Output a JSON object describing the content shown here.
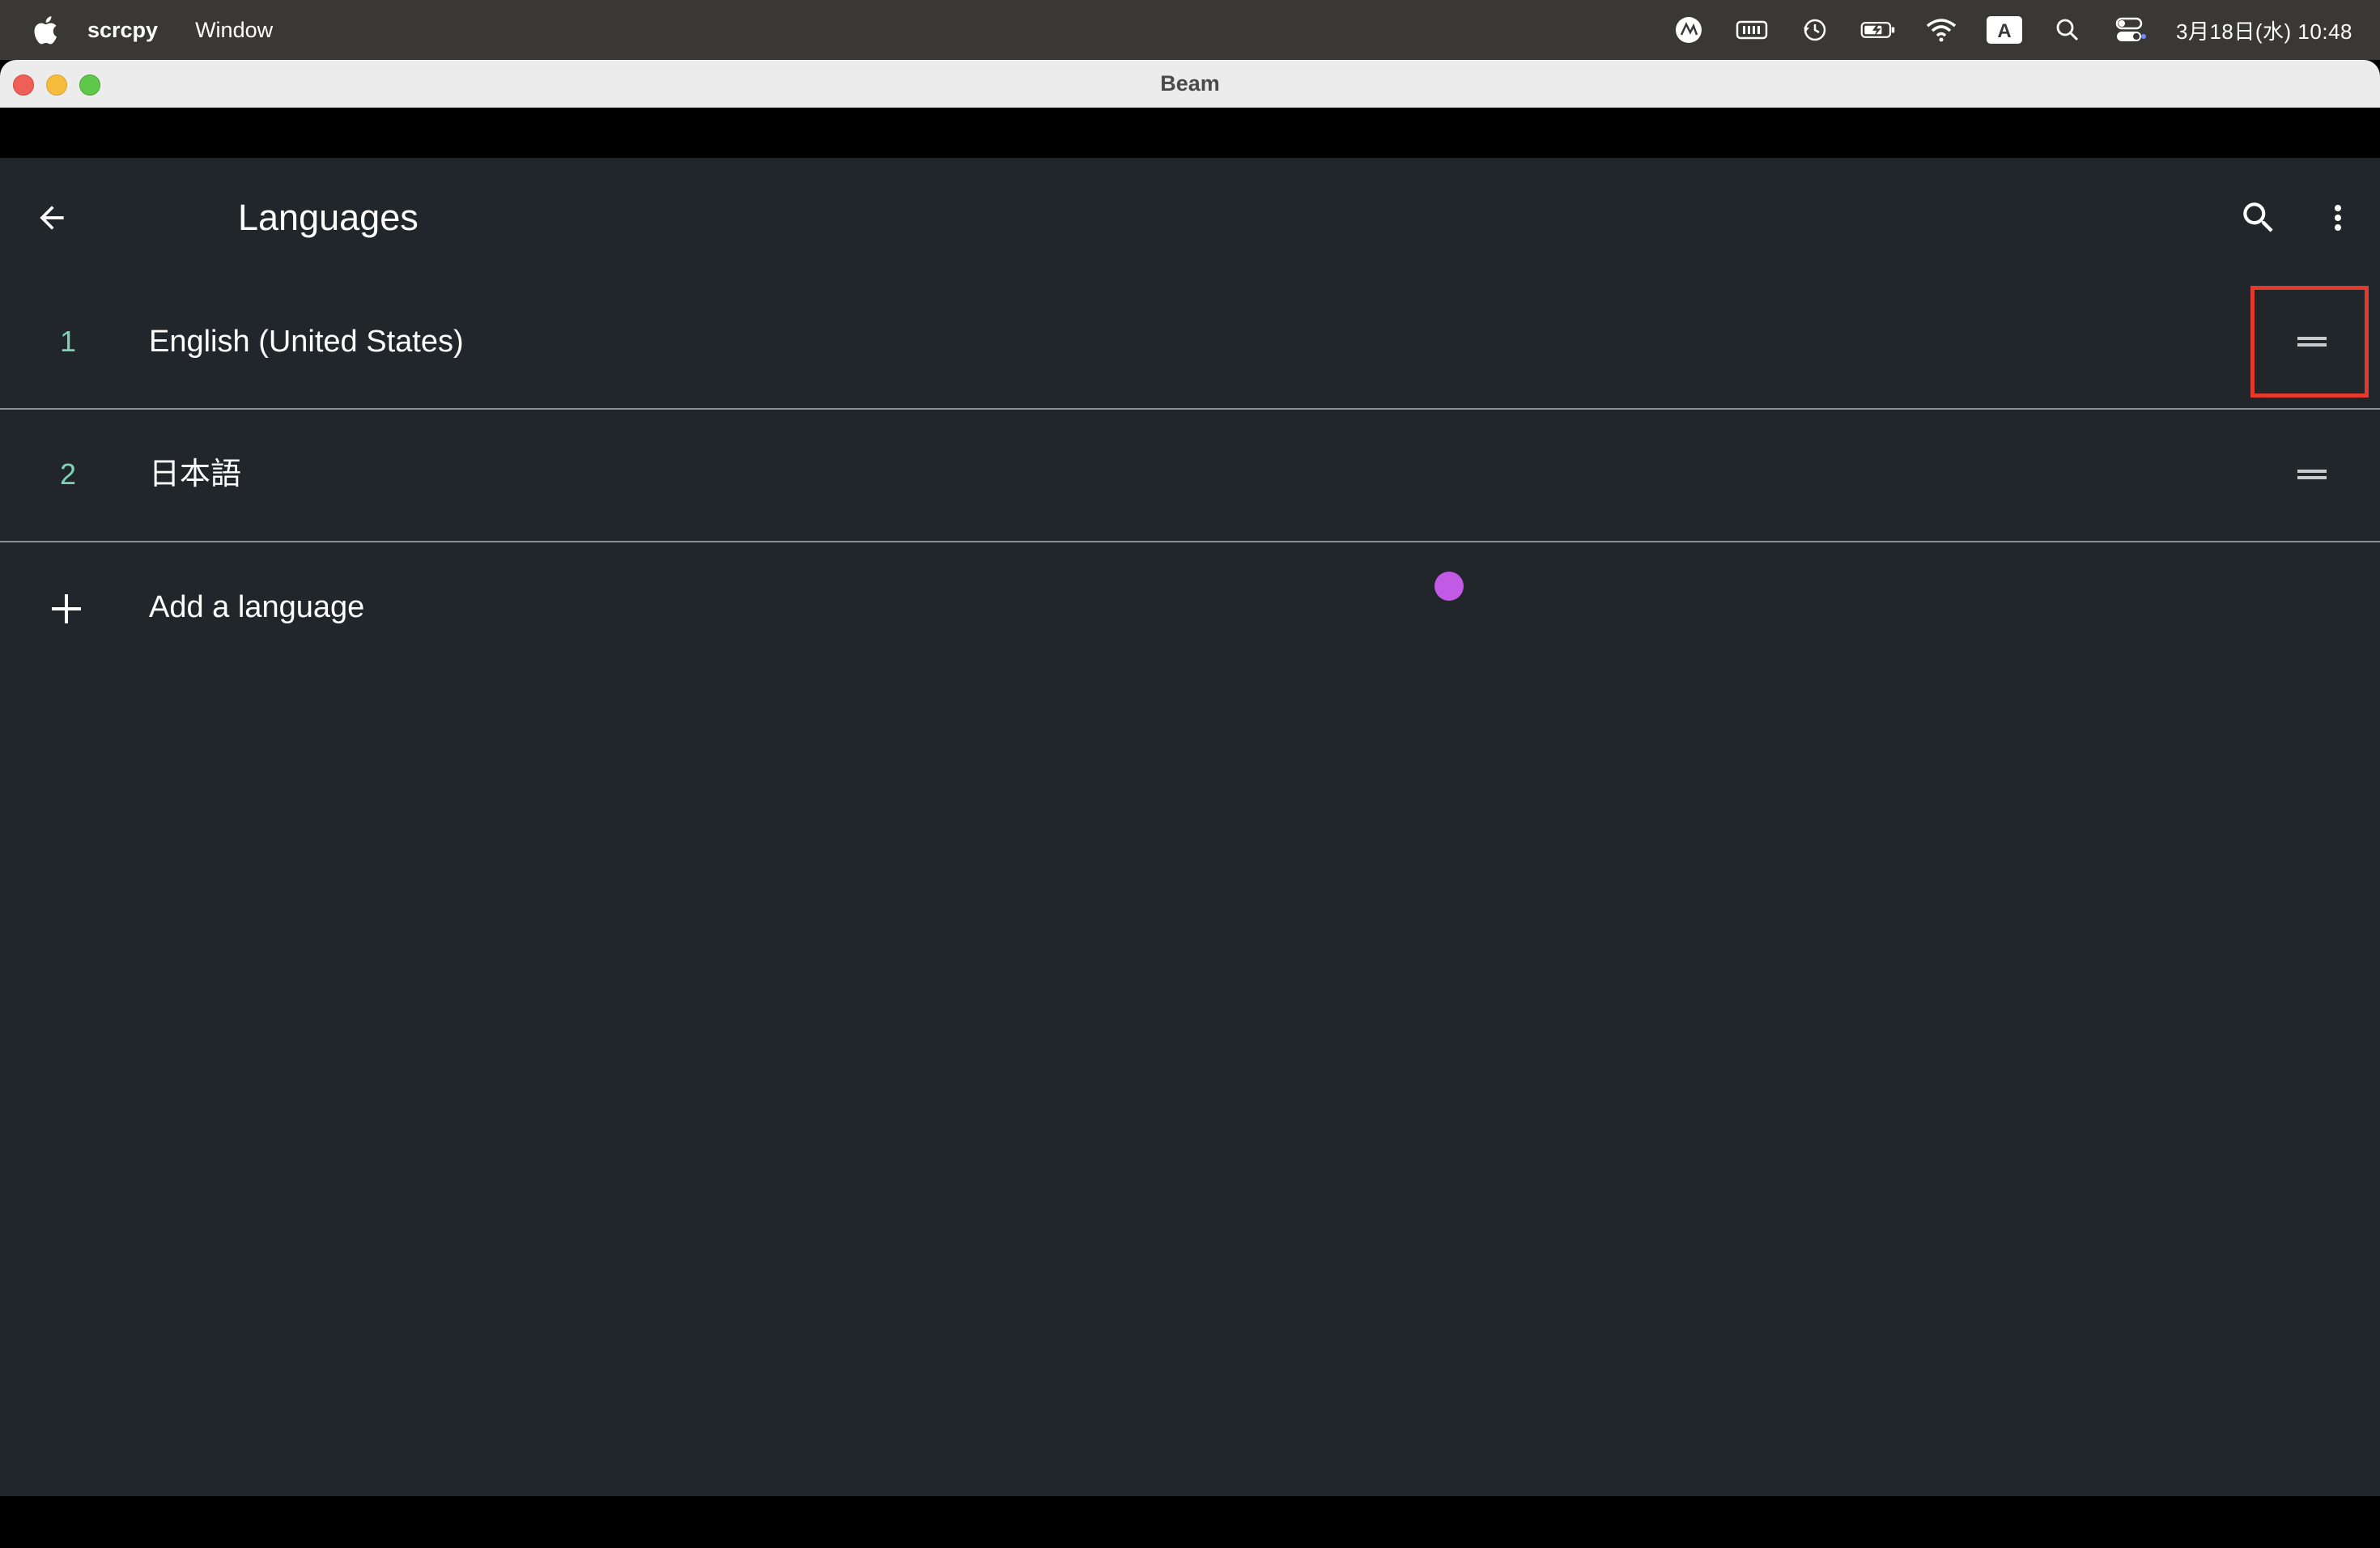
{
  "menubar": {
    "app_name": "scrcpy",
    "menu_window": "Window",
    "clock": "3月18日(水) 10:48",
    "status_icons": [
      "user-accessibility-icon",
      "keyboard-brightness-icon",
      "time-machine-icon",
      "battery-charging-icon",
      "wifi-icon",
      "input-source-icon",
      "spotlight-search-icon",
      "control-center-icon"
    ],
    "input_source_label": "A"
  },
  "window": {
    "title": "Beam"
  },
  "appbar": {
    "title": "Languages"
  },
  "languages": [
    {
      "index": "1",
      "name": "English (United States)"
    },
    {
      "index": "2",
      "name": "日本語"
    }
  ],
  "add_language": {
    "label": "Add a language"
  },
  "colors": {
    "background": "#21262b",
    "index_accent": "#7fd3b4",
    "highlight_box": "#e33a2e",
    "touch_indicator": "#c35ae6"
  }
}
